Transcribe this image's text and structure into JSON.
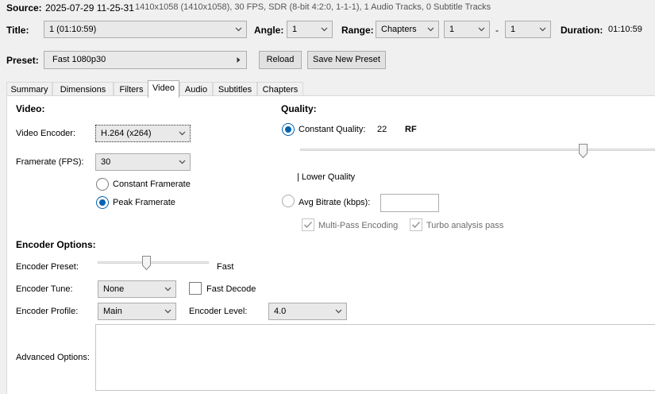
{
  "source": {
    "label": "Source:",
    "name": "2025-07-29 11-25-31",
    "details": "1410x1058 (1410x1058), 30 FPS, SDR (8-bit 4:2:0, 1-1-1), 1 Audio Tracks, 0 Subtitle Tracks"
  },
  "title_row": {
    "title_label": "Title:",
    "title_value": "1 (01:10:59)",
    "angle_label": "Angle:",
    "angle_value": "1",
    "range_label": "Range:",
    "range_type": "Chapters",
    "range_start": "1",
    "range_sep": "-",
    "range_end": "1",
    "duration_label": "Duration:",
    "duration_value": "01:10:59"
  },
  "preset_row": {
    "label": "Preset:",
    "value": "Fast 1080p30",
    "reload": "Reload",
    "save_new": "Save New Preset"
  },
  "tabs": [
    "Summary",
    "Dimensions",
    "Filters",
    "Video",
    "Audio",
    "Subtitles",
    "Chapters"
  ],
  "active_tab": "Video",
  "video": {
    "heading": "Video:",
    "encoder_label": "Video Encoder:",
    "encoder_value": "H.264 (x264)",
    "framerate_label": "Framerate (FPS):",
    "framerate_value": "30",
    "constant_framerate": "Constant Framerate",
    "peak_framerate": "Peak Framerate",
    "framerate_mode": "peak"
  },
  "quality": {
    "heading": "Quality:",
    "constant_quality_label": "Constant Quality:",
    "cq_value": "22",
    "cq_unit": "RF",
    "slider_fraction": 0.798,
    "lower_quality": "| Lower Quality",
    "avg_bitrate_label": "Avg Bitrate (kbps):",
    "avg_bitrate_value": "",
    "multipass": "Multi-Pass Encoding",
    "turbo": "Turbo analysis pass",
    "multipass_checked": true,
    "turbo_checked": true
  },
  "encoder_options": {
    "heading": "Encoder Options:",
    "preset_label": "Encoder Preset:",
    "preset_value": "Fast",
    "preset_fraction": 0.44,
    "tune_label": "Encoder Tune:",
    "tune_value": "None",
    "fast_decode": "Fast Decode",
    "fast_decode_checked": false,
    "profile_label": "Encoder Profile:",
    "profile_value": "Main",
    "level_label": "Encoder Level:",
    "level_value": "4.0",
    "advanced_label": "Advanced Options:",
    "advanced_value": ""
  },
  "colors": {
    "accent": "#0063b1",
    "window_bg": "#f0f0f0",
    "panel_bg": "#ffffff",
    "control_border": "#adadad"
  },
  "icons": {
    "dropdown": "chevron-down-icon",
    "preset_menu": "triangle-right-icon",
    "check": "check-mark-icon"
  }
}
